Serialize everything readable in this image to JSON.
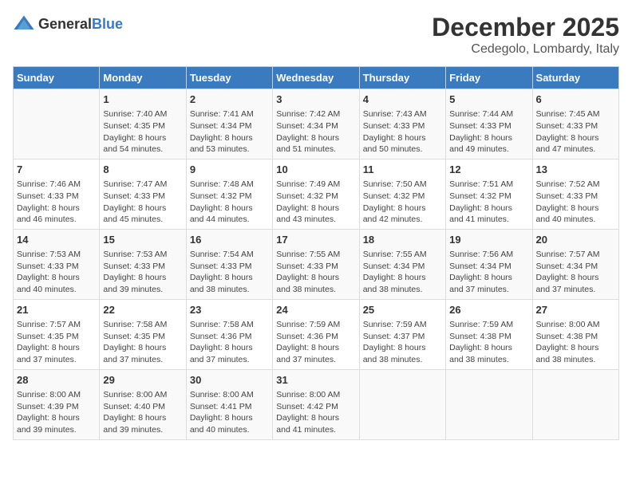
{
  "header": {
    "logo_general": "General",
    "logo_blue": "Blue",
    "title": "December 2025",
    "subtitle": "Cedegolo, Lombardy, Italy"
  },
  "weekdays": [
    "Sunday",
    "Monday",
    "Tuesday",
    "Wednesday",
    "Thursday",
    "Friday",
    "Saturday"
  ],
  "weeks": [
    [
      {
        "day": "",
        "info": ""
      },
      {
        "day": "1",
        "info": "Sunrise: 7:40 AM\nSunset: 4:35 PM\nDaylight: 8 hours\nand 54 minutes."
      },
      {
        "day": "2",
        "info": "Sunrise: 7:41 AM\nSunset: 4:34 PM\nDaylight: 8 hours\nand 53 minutes."
      },
      {
        "day": "3",
        "info": "Sunrise: 7:42 AM\nSunset: 4:34 PM\nDaylight: 8 hours\nand 51 minutes."
      },
      {
        "day": "4",
        "info": "Sunrise: 7:43 AM\nSunset: 4:33 PM\nDaylight: 8 hours\nand 50 minutes."
      },
      {
        "day": "5",
        "info": "Sunrise: 7:44 AM\nSunset: 4:33 PM\nDaylight: 8 hours\nand 49 minutes."
      },
      {
        "day": "6",
        "info": "Sunrise: 7:45 AM\nSunset: 4:33 PM\nDaylight: 8 hours\nand 47 minutes."
      }
    ],
    [
      {
        "day": "7",
        "info": "Sunrise: 7:46 AM\nSunset: 4:33 PM\nDaylight: 8 hours\nand 46 minutes."
      },
      {
        "day": "8",
        "info": "Sunrise: 7:47 AM\nSunset: 4:33 PM\nDaylight: 8 hours\nand 45 minutes."
      },
      {
        "day": "9",
        "info": "Sunrise: 7:48 AM\nSunset: 4:32 PM\nDaylight: 8 hours\nand 44 minutes."
      },
      {
        "day": "10",
        "info": "Sunrise: 7:49 AM\nSunset: 4:32 PM\nDaylight: 8 hours\nand 43 minutes."
      },
      {
        "day": "11",
        "info": "Sunrise: 7:50 AM\nSunset: 4:32 PM\nDaylight: 8 hours\nand 42 minutes."
      },
      {
        "day": "12",
        "info": "Sunrise: 7:51 AM\nSunset: 4:32 PM\nDaylight: 8 hours\nand 41 minutes."
      },
      {
        "day": "13",
        "info": "Sunrise: 7:52 AM\nSunset: 4:33 PM\nDaylight: 8 hours\nand 40 minutes."
      }
    ],
    [
      {
        "day": "14",
        "info": "Sunrise: 7:53 AM\nSunset: 4:33 PM\nDaylight: 8 hours\nand 40 minutes."
      },
      {
        "day": "15",
        "info": "Sunrise: 7:53 AM\nSunset: 4:33 PM\nDaylight: 8 hours\nand 39 minutes."
      },
      {
        "day": "16",
        "info": "Sunrise: 7:54 AM\nSunset: 4:33 PM\nDaylight: 8 hours\nand 38 minutes."
      },
      {
        "day": "17",
        "info": "Sunrise: 7:55 AM\nSunset: 4:33 PM\nDaylight: 8 hours\nand 38 minutes."
      },
      {
        "day": "18",
        "info": "Sunrise: 7:55 AM\nSunset: 4:34 PM\nDaylight: 8 hours\nand 38 minutes."
      },
      {
        "day": "19",
        "info": "Sunrise: 7:56 AM\nSunset: 4:34 PM\nDaylight: 8 hours\nand 37 minutes."
      },
      {
        "day": "20",
        "info": "Sunrise: 7:57 AM\nSunset: 4:34 PM\nDaylight: 8 hours\nand 37 minutes."
      }
    ],
    [
      {
        "day": "21",
        "info": "Sunrise: 7:57 AM\nSunset: 4:35 PM\nDaylight: 8 hours\nand 37 minutes."
      },
      {
        "day": "22",
        "info": "Sunrise: 7:58 AM\nSunset: 4:35 PM\nDaylight: 8 hours\nand 37 minutes."
      },
      {
        "day": "23",
        "info": "Sunrise: 7:58 AM\nSunset: 4:36 PM\nDaylight: 8 hours\nand 37 minutes."
      },
      {
        "day": "24",
        "info": "Sunrise: 7:59 AM\nSunset: 4:36 PM\nDaylight: 8 hours\nand 37 minutes."
      },
      {
        "day": "25",
        "info": "Sunrise: 7:59 AM\nSunset: 4:37 PM\nDaylight: 8 hours\nand 38 minutes."
      },
      {
        "day": "26",
        "info": "Sunrise: 7:59 AM\nSunset: 4:38 PM\nDaylight: 8 hours\nand 38 minutes."
      },
      {
        "day": "27",
        "info": "Sunrise: 8:00 AM\nSunset: 4:38 PM\nDaylight: 8 hours\nand 38 minutes."
      }
    ],
    [
      {
        "day": "28",
        "info": "Sunrise: 8:00 AM\nSunset: 4:39 PM\nDaylight: 8 hours\nand 39 minutes."
      },
      {
        "day": "29",
        "info": "Sunrise: 8:00 AM\nSunset: 4:40 PM\nDaylight: 8 hours\nand 39 minutes."
      },
      {
        "day": "30",
        "info": "Sunrise: 8:00 AM\nSunset: 4:41 PM\nDaylight: 8 hours\nand 40 minutes."
      },
      {
        "day": "31",
        "info": "Sunrise: 8:00 AM\nSunset: 4:42 PM\nDaylight: 8 hours\nand 41 minutes."
      },
      {
        "day": "",
        "info": ""
      },
      {
        "day": "",
        "info": ""
      },
      {
        "day": "",
        "info": ""
      }
    ]
  ]
}
